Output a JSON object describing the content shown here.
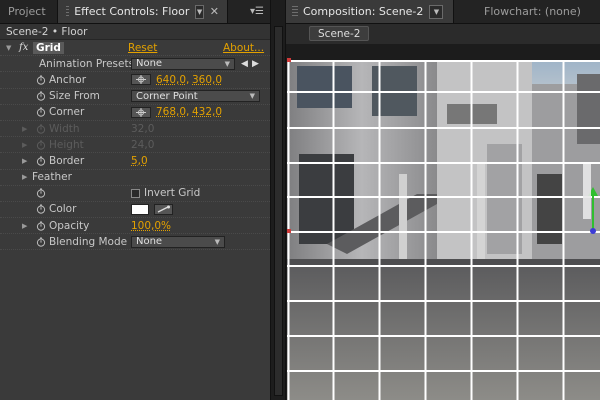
{
  "left_tabs": {
    "project": "Project",
    "effect_controls": "Effect Controls: Floor"
  },
  "right_tabs": {
    "composition": "Composition: Scene-2",
    "flowchart": "Flowchart: (none)"
  },
  "scene_button": "Scene-2",
  "breadcrumb": "Scene-2 • Floor",
  "effect": {
    "fx_badge": "fx",
    "name": "Grid",
    "reset_label": "Reset",
    "about_label": "About...",
    "animation_presets_label": "Animation Presets:",
    "animation_presets_value": "None",
    "anchor": {
      "label": "Anchor",
      "x": "640,0",
      "y": "360,0"
    },
    "size_from": {
      "label": "Size From",
      "value": "Corner Point"
    },
    "corner": {
      "label": "Corner",
      "x": "768,0",
      "y": "432,0"
    },
    "width": {
      "label": "Width",
      "value": "32,0"
    },
    "height": {
      "label": "Height",
      "value": "24,0"
    },
    "border": {
      "label": "Border",
      "value": "5,0"
    },
    "feather": {
      "label": "Feather"
    },
    "invert_grid": {
      "label": "Invert Grid"
    },
    "color": {
      "label": "Color",
      "value": "#ffffff"
    },
    "opacity": {
      "label": "Opacity",
      "value": "100,0%"
    },
    "blending_mode": {
      "label": "Blending Mode",
      "value": "None"
    }
  },
  "colors": {
    "value_orange": "#e3a100",
    "panel": "#3a3a3a"
  }
}
